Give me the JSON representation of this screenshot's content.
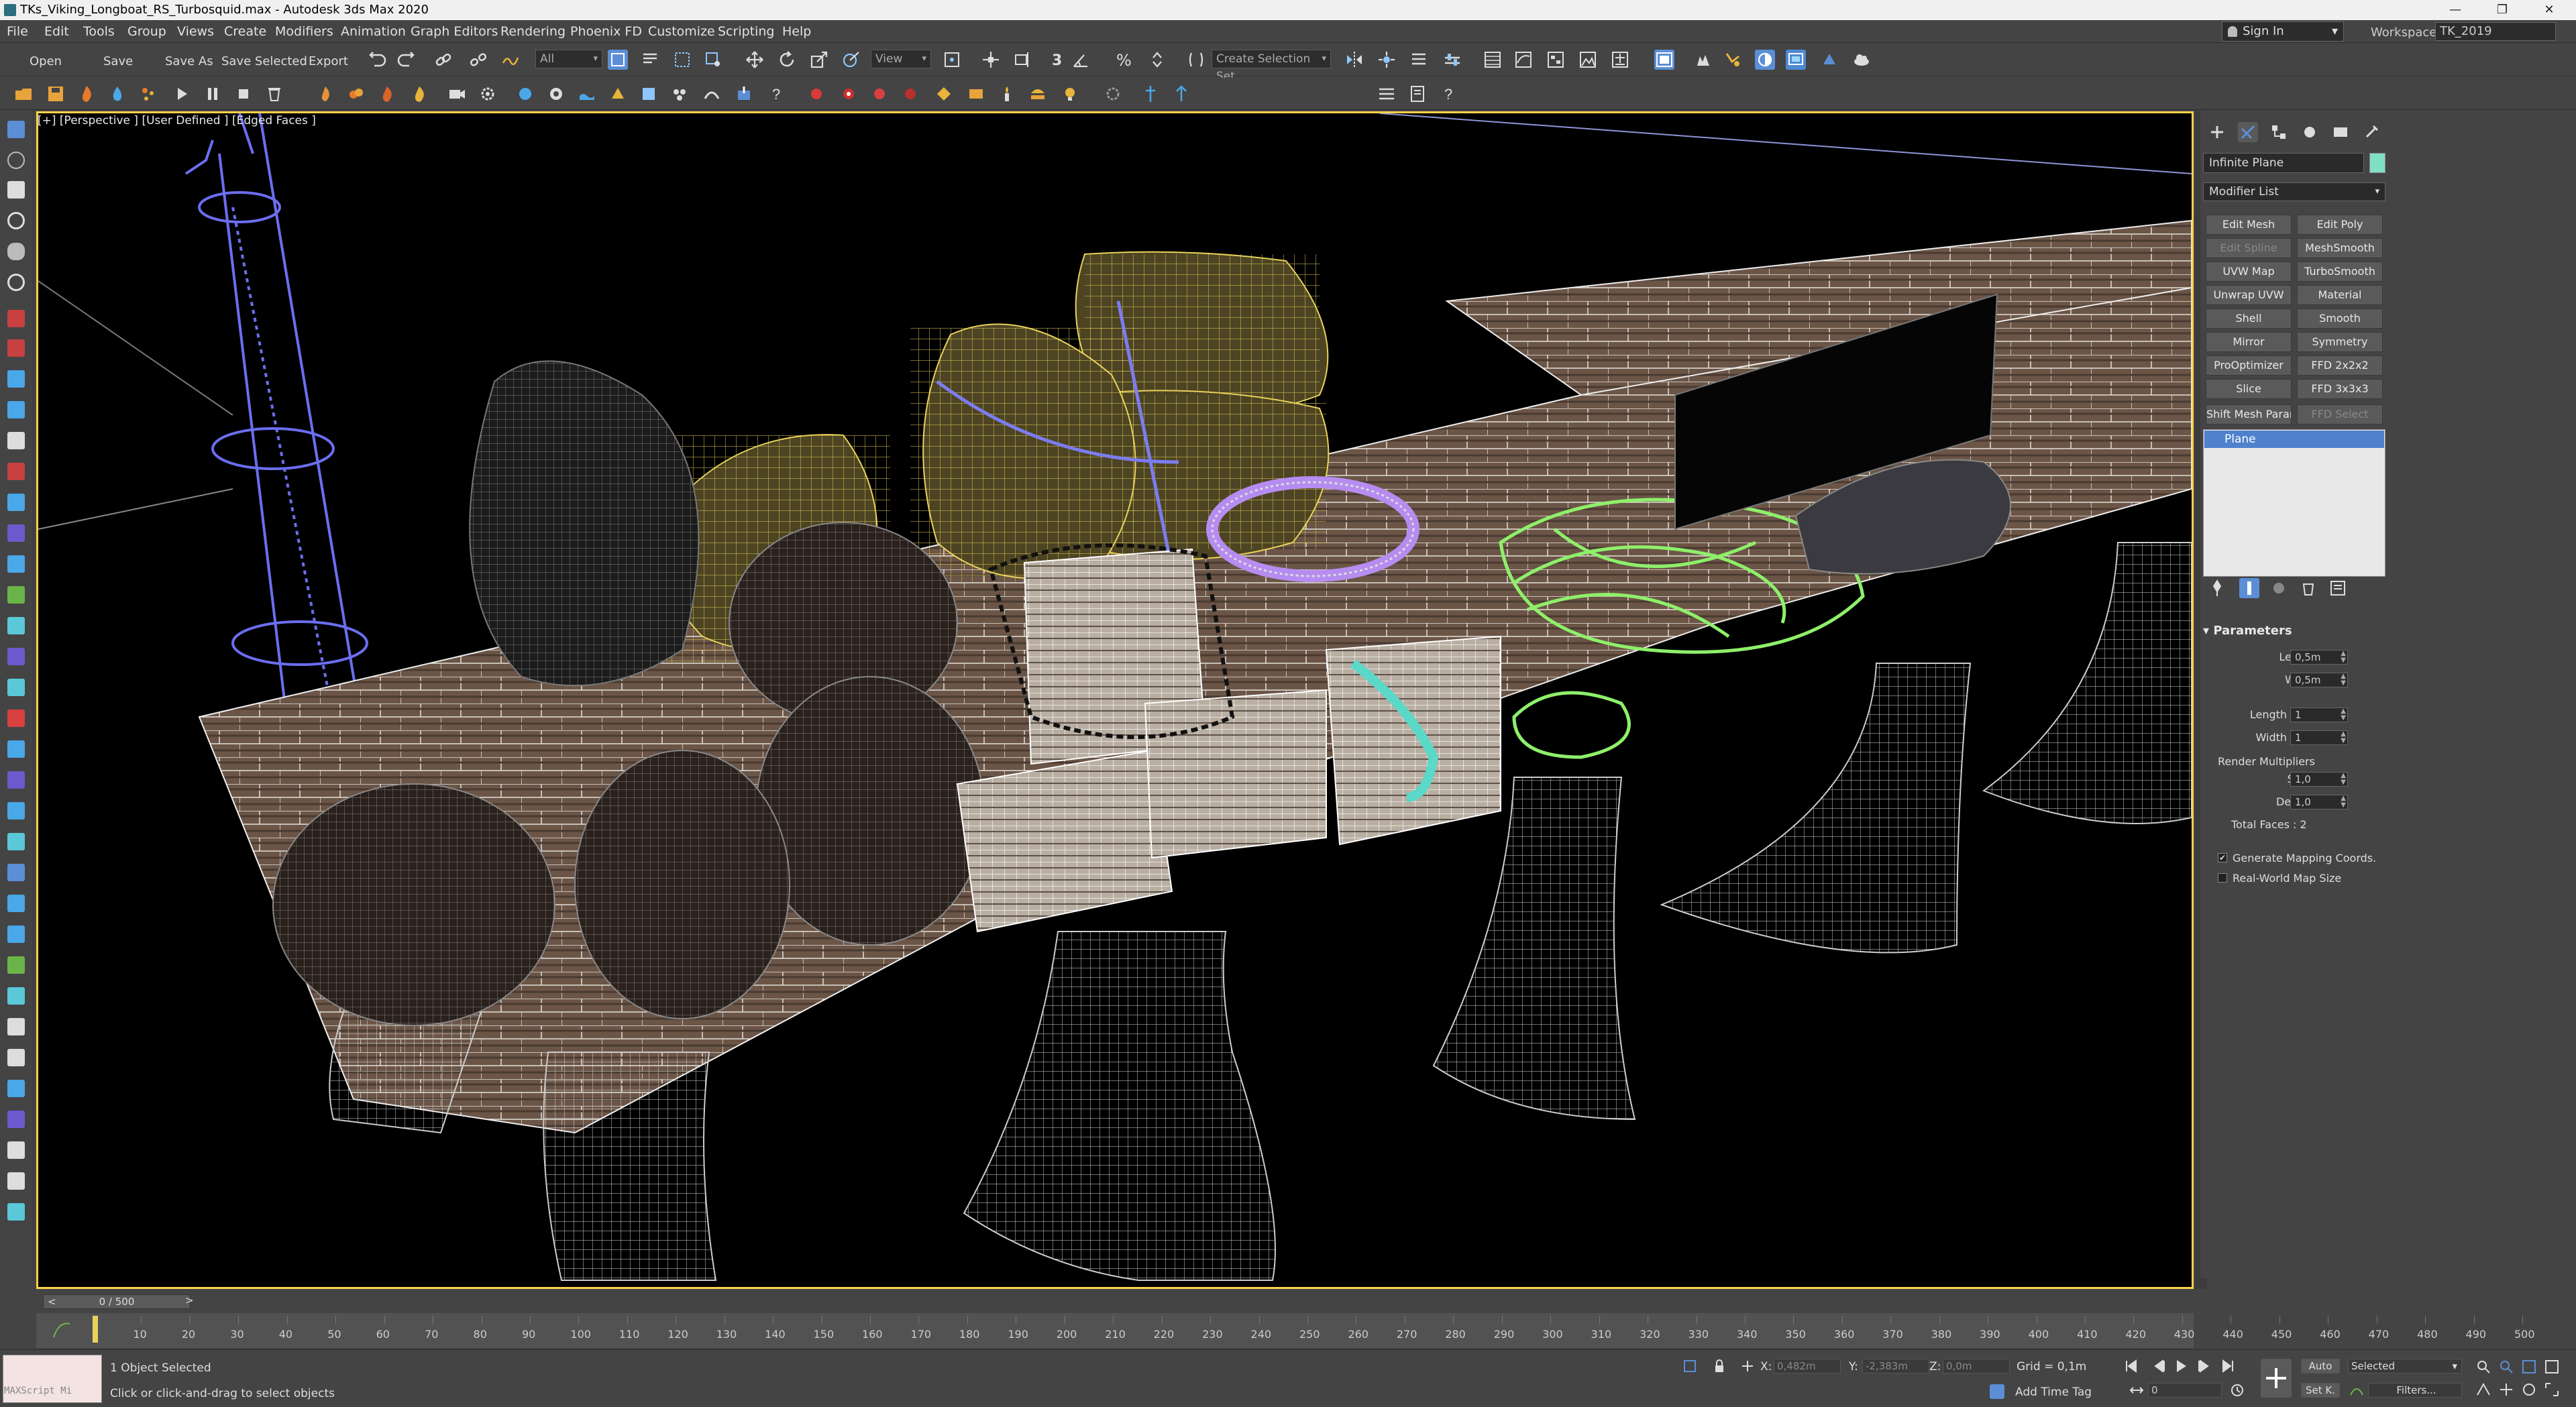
{
  "window": {
    "title": "TKs_Viking_Longboat_RS_Turbosquid.max - Autodesk 3ds Max 2020",
    "controls": [
      "—",
      "❐",
      "✕"
    ]
  },
  "menubar": {
    "items": [
      "File",
      "Edit",
      "Tools",
      "Group",
      "Views",
      "Create",
      "Modifiers",
      "Animation",
      "Graph Editors",
      "Rendering",
      "Phoenix FD",
      "Customize",
      "Scripting",
      "Help"
    ],
    "signin": "Sign In",
    "workspaces_label": "Workspaces:",
    "workspace": "TK_2019"
  },
  "toolbar": {
    "open": "Open",
    "save": "Save",
    "save_as": "Save As",
    "save_selected": "Save Selected",
    "export": "Export",
    "filter": "All",
    "view": "View",
    "create_selection_set": "Create Selection Set",
    "snap_label": "3",
    "percent_label": "%"
  },
  "viewport": {
    "label": "[+] [Perspective ] [User Defined ] [Edged Faces ]"
  },
  "command_panel": {
    "object_name": "Infinite Plane",
    "object_color": "#7fe0c3",
    "modifier_list": "Modifier List",
    "modifier_buttons": [
      [
        "Edit Mesh",
        "Edit Poly"
      ],
      [
        "Edit Spline",
        "MeshSmooth"
      ],
      [
        "UVW Map",
        "TurboSmooth"
      ],
      [
        "Unwrap UVW",
        "Material"
      ],
      [
        "Shell",
        "Smooth"
      ],
      [
        "Mirror",
        "Symmetry"
      ],
      [
        "ProOptimizer",
        "FFD 2x2x2"
      ],
      [
        "Slice",
        "FFD 3x3x3"
      ],
      [
        "Shift Mesh Parame",
        "FFD Select"
      ]
    ],
    "stack_item": "Plane",
    "parameters": {
      "header": "Parameters",
      "length_label": "Length:",
      "length": "0,5m",
      "width_label": "Width:",
      "width": "0,5m",
      "length_segs_label": "Length Segs:",
      "length_segs": "1",
      "width_segs_label": "Width Segs:",
      "width_segs": "1",
      "render_multipliers": "Render Multipliers",
      "scale_label": "Scale:",
      "scale": "1,0",
      "density_label": "Density:",
      "density": "1,0",
      "total_faces": "Total Faces : 2",
      "gen_mapping": "Generate Mapping Coords.",
      "gen_mapping_checked": true,
      "real_world": "Real-World Map Size",
      "real_world_checked": false
    }
  },
  "timeline": {
    "frame": "0 / 500",
    "prev": "<",
    "next": ">",
    "ticks": [
      "10",
      "20",
      "30",
      "40",
      "50",
      "60",
      "70",
      "80",
      "90",
      "100",
      "110",
      "120",
      "130",
      "140",
      "150",
      "160",
      "170",
      "180",
      "190",
      "200",
      "210",
      "220",
      "230",
      "240",
      "250",
      "260",
      "270",
      "280",
      "290",
      "300",
      "310",
      "320",
      "330",
      "340",
      "350",
      "360",
      "370",
      "380",
      "390",
      "400",
      "410",
      "420",
      "430",
      "440",
      "450",
      "460",
      "470",
      "480",
      "490",
      "500"
    ]
  },
  "status": {
    "maxscript": "MAXScript Mi",
    "objects_selected": "1 Object Selected",
    "prompt": "Click or click-and-drag to select objects",
    "x_label": "X:",
    "x_value": "0,482m",
    "y_label": "Y:",
    "y_value": "-2,383m",
    "z_label": "Z:",
    "z_value": "0,0m",
    "grid": "Grid = 0,1m",
    "add_time_tag": "Add Time Tag",
    "auto": "Auto",
    "set_k": "Set K.",
    "selected": "Selected",
    "filters": "Filters...",
    "frame_field": "0"
  }
}
